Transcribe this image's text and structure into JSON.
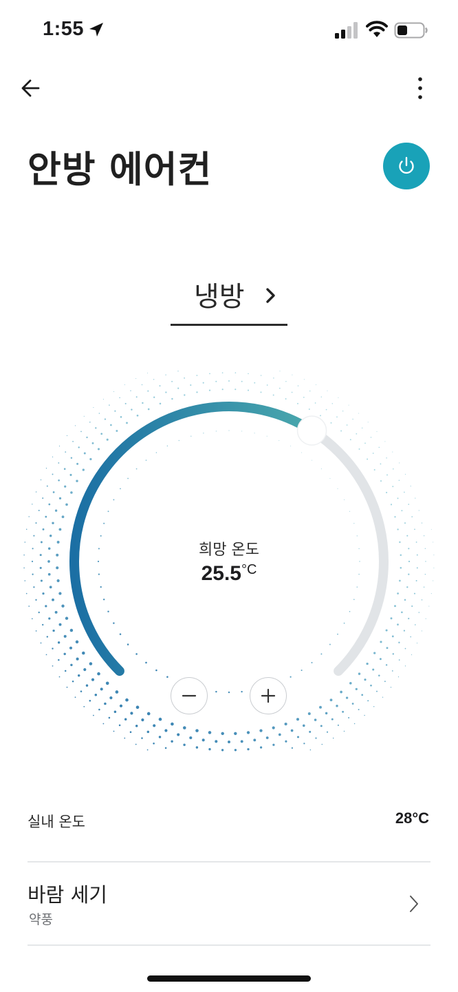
{
  "status_bar": {
    "time": "1:55"
  },
  "header": {
    "title": "안방 에어컨"
  },
  "mode": {
    "label": "냉방"
  },
  "dial": {
    "label": "희망 온도",
    "target_value": "25.5",
    "unit": "°C",
    "progress": 0.62,
    "colors": {
      "arc_start": "#1b6fa4",
      "arc_end": "#4aa8ad",
      "track": "#e1e4e7",
      "dots_start": "#1a69a4",
      "dots_end": "#45b3c4"
    }
  },
  "indoor": {
    "label": "실내 온도",
    "value": "28°C"
  },
  "wind": {
    "title": "바람 세기",
    "value": "약풍"
  },
  "colors": {
    "power": "#19a2b8",
    "text": "#1d1d1f"
  }
}
